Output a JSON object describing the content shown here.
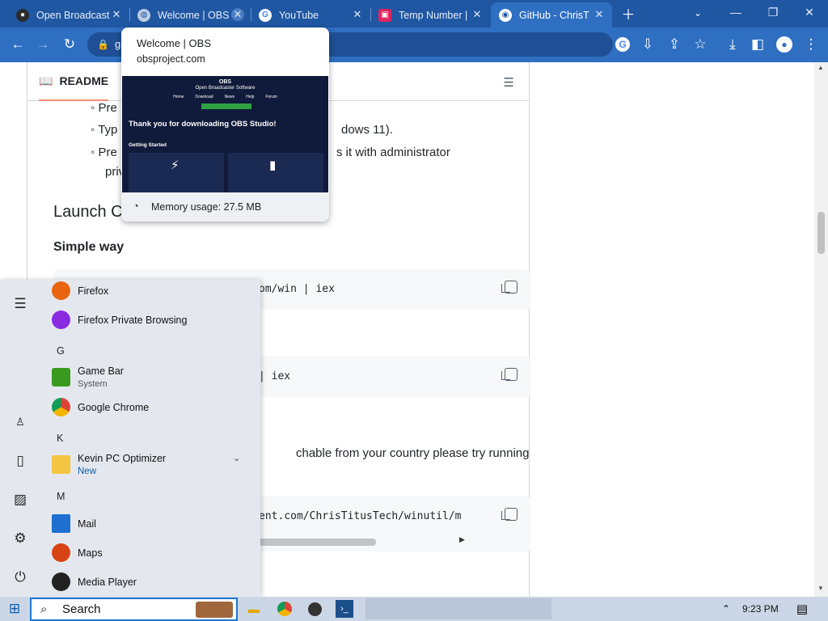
{
  "tabs": [
    {
      "title": "Open Broadcast",
      "active": false
    },
    {
      "title": "Welcome | OBS",
      "active": false
    },
    {
      "title": "YouTube",
      "active": false
    },
    {
      "title": "Temp Number |",
      "active": false
    },
    {
      "title": "GitHub - ChrisT",
      "active": true
    }
  ],
  "omnibox": {
    "text": "g"
  },
  "hovercard": {
    "title": "Welcome | OBS",
    "domain": "obsproject.com",
    "memory": "Memory usage: 27.5 MB",
    "preview": {
      "brand": "OBS",
      "brand_sub": "Open Broadcaster Software",
      "nav": [
        "Home",
        "Download",
        "News",
        "Help",
        "Forum"
      ],
      "heading": "Thank you for downloading OBS Studio!",
      "getting_started": "Getting Started"
    }
  },
  "readme": {
    "tab_label": "README",
    "bullets": [
      "Pre",
      "Typ",
      "Pre"
    ],
    "bullet2_tail": "dows 11).",
    "bullet3_tail": "s it with administrator",
    "bullet3_wrap": "priv",
    "heading_launch": "Launch Co",
    "heading_simple": "Simple way",
    "code1": "om/win | iex",
    "code2": "| iex",
    "para": "chable from your country please try running",
    "code3": "ent.com/ChrisTitusTech/winutil/m"
  },
  "startmenu": {
    "items": [
      {
        "type": "app",
        "name": "Firefox",
        "sub": "",
        "icon": "firefox-icon",
        "color": "#e8640f"
      },
      {
        "type": "app",
        "name": "Firefox Private Browsing",
        "sub": "",
        "icon": "firefox-private-icon",
        "color": "#8a2be2"
      },
      {
        "type": "letter",
        "name": "G"
      },
      {
        "type": "app",
        "name": "Game Bar",
        "sub": "System",
        "icon": "game-bar-icon",
        "color": "#3a9a1f"
      },
      {
        "type": "app",
        "name": "Google Chrome",
        "sub": "",
        "icon": "chrome-icon",
        "color": "#1a73e8"
      },
      {
        "type": "letter",
        "name": "K"
      },
      {
        "type": "app",
        "name": "Kevin PC Optimizer",
        "sub": "New",
        "icon": "folder-icon",
        "color": "#f4c542"
      },
      {
        "type": "letter",
        "name": "M"
      },
      {
        "type": "app",
        "name": "Mail",
        "sub": "",
        "icon": "mail-icon",
        "color": "#1e6fd0"
      },
      {
        "type": "app",
        "name": "Maps",
        "sub": "",
        "icon": "maps-icon",
        "color": "#d84315"
      },
      {
        "type": "app",
        "name": "Media Player",
        "sub": "",
        "icon": "media-player-icon",
        "color": "#222222"
      }
    ]
  },
  "taskbar": {
    "search": "Search",
    "clock": "9:23 PM"
  }
}
